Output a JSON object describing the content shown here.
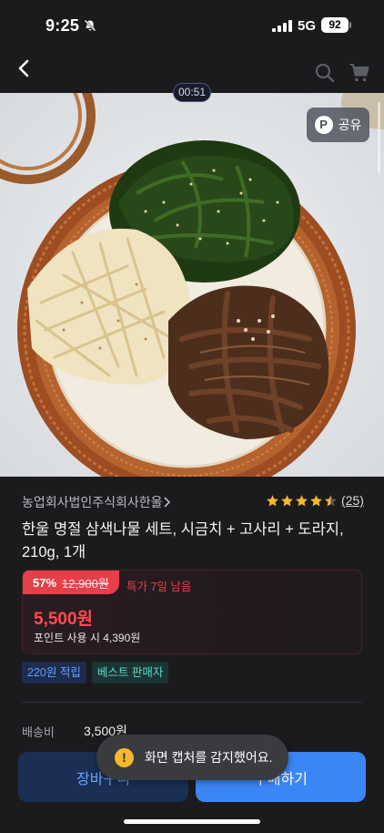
{
  "status_bar": {
    "time": "9:25",
    "network": "5G",
    "battery": "92"
  },
  "nav": {
    "back_icon": "chevron-left-icon",
    "search_icon": "search-icon",
    "cart_icon": "cart-icon"
  },
  "hero": {
    "timer": "00:51",
    "share_icon_letter": "P",
    "share_label": "공유"
  },
  "product": {
    "seller": "농업회사법인주식회사한울",
    "rating_stars": 4.5,
    "review_count": "(25)",
    "title": "한울 명절 삼색나물 세트, 시금치 + 고사리 + 도라지, 210g, 1개"
  },
  "price": {
    "discount": "57%",
    "original_price": "12,900원",
    "deal_label": "특가 7일 남음",
    "sale_price": "5,500원",
    "point_price": "포인트 사용 시 4,390원"
  },
  "badges": {
    "points": "220원 적립",
    "best_seller": "베스트 판매자"
  },
  "shipping": {
    "label": "배송비",
    "value": "3,500원"
  },
  "actions": {
    "cart_label": "장바구니",
    "buy_label": "구매하기"
  },
  "toast": {
    "icon_glyph": "!",
    "message": "화면 캡처를 감지했어요."
  },
  "colors": {
    "background": "#1b1b1d",
    "sale_red": "#e5404a",
    "primary_blue": "#3b86f5",
    "star_yellow": "#f5b82e"
  }
}
